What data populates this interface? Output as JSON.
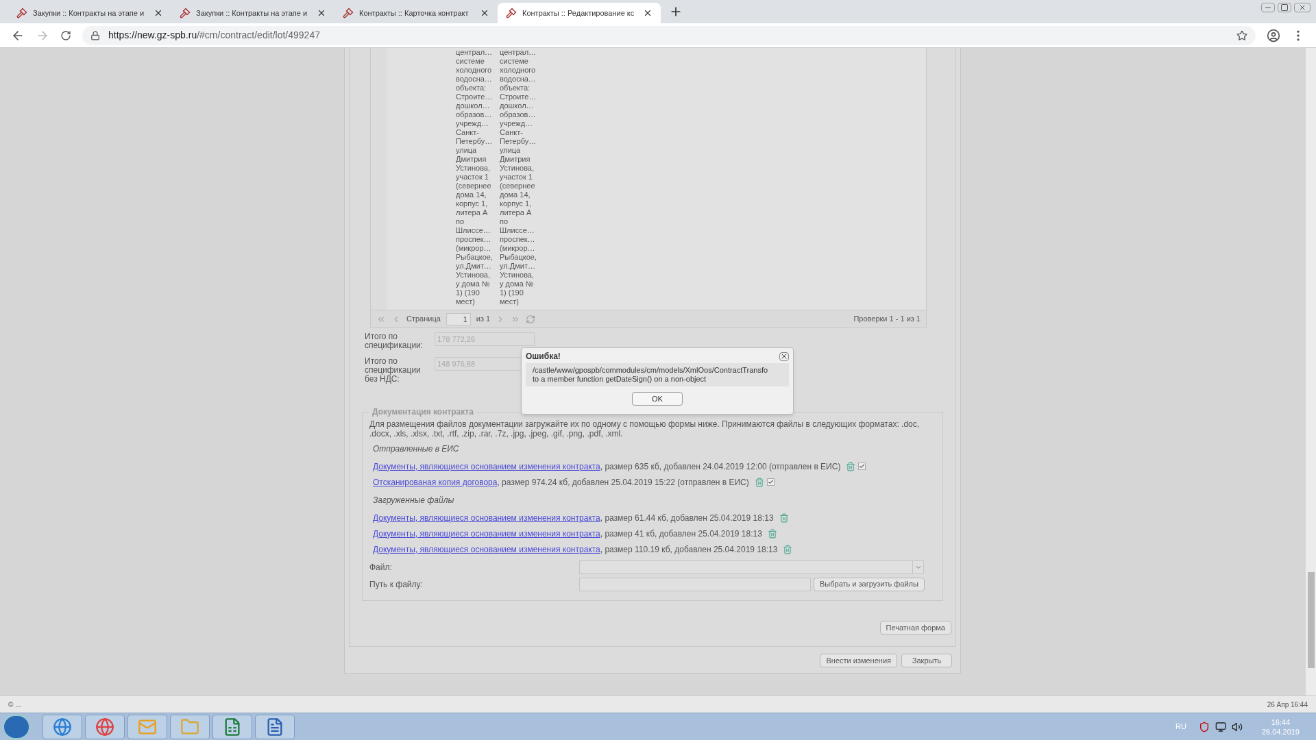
{
  "browser": {
    "tabs": [
      {
        "title": "Закупки :: Контракты на этапе и",
        "selected": false
      },
      {
        "title": "Закупки :: Контракты на этапе и",
        "selected": false
      },
      {
        "title": "Контракты :: Карточка контракт",
        "selected": false
      },
      {
        "title": "Контракты :: Редактирование кс",
        "selected": true
      }
    ],
    "url_host": "https://new.gz-spb.ru",
    "url_path": "/#cm/contract/edit/lot/499247"
  },
  "grid": {
    "rows": [
      {
        "column_1": "централ…\nсистеме\nхолодного\nводосна…\nобъекта:\nСтроите…\nдошкол…\nобразов…\nучрежд…\nСанкт-\nПетербу…\nулица\nДмитрия\nУстинова,\nучасток 1\n(севернее\nдома 14,\nкорпус 1,\nлитера А\nпо\nШлиссе…\nпроспек…\n(микрор…\nРыбацкое,\nул.Дмит…\nУстинова,\nу дома №\n1) (190\nмест)",
        "column_2": "централ…\nсистеме\nхолодного\nводосна…\nобъекта:\nСтроите…\nдошкол…\nобразов…\nучрежд…\nСанкт-\nПетербу…\nулица\nДмитрия\nУстинова,\nучасток 1\n(севернее\nдома 14,\nкорпус 1,\nлитера А\nпо\nШлиссе…\nпроспек…\n(микрор…\nРыбацкое,\nул.Дмит…\nУстинова,\nу дома №\n1) (190\nмест)"
      }
    ],
    "pager": {
      "page_label": "Страница",
      "page": "1",
      "of": "из 1",
      "summary": "Проверки 1 - 1 из 1"
    }
  },
  "totals": [
    {
      "label": "Итого по спецификации:",
      "value": "178 772,26"
    },
    {
      "label": "Итого по спецификации без НДС:",
      "value": "148 976,88"
    }
  ],
  "documents": {
    "legend": "Документация контракта",
    "intro": "Для размещения файлов документации загружайте их по одному с помощью формы ниже. Принимаются файлы в следующих форматах: .doc, .docx, .xls, .xlsx, .txt, .rtf, .zip, .rar, .7z, .jpg, .jpeg, .gif, .png, .pdf, .xml.",
    "groups": [
      {
        "heading": "Отправленные в ЕИС",
        "files": [
          {
            "kind": "sent",
            "link": "Документы, являющиеся основанием изменения контракта",
            "details": ", размер 635 кб, добавлен 24.04.2019 12:00 (отправлен в ЕИС)",
            "checked": true
          },
          {
            "kind": "sent",
            "link": "Отсканированая копия договора",
            "details": ", размер 974.24 кб, добавлен 25.04.2019 15:22 (отправлен в ЕИС)",
            "checked": true
          }
        ]
      },
      {
        "heading": "Загруженные файлы",
        "files": [
          {
            "kind": "uploaded",
            "link": "Документы, являющиеся основанием изменения контракта",
            "details": ", размер 61.44 кб, добавлен 25.04.2019 18:13"
          },
          {
            "kind": "uploaded",
            "link": "Документы, являющиеся основанием изменения контракта",
            "details": ", размер 41 кб, добавлен 25.04.2019 18:13"
          },
          {
            "kind": "uploaded",
            "link": "Документы, являющиеся основанием изменения контракта",
            "details": ", размер 110.19 кб, добавлен 25.04.2019 18:13"
          }
        ]
      }
    ],
    "file_label": "Файл:",
    "path_label": "Путь к файлу:",
    "upload_button": "Выбрать и загрузить файлы"
  },
  "print_button": "Печатная форма",
  "buttons": [
    "Внести изменения",
    "Закрыть"
  ],
  "dialog": {
    "title": "Ошибка!",
    "message": "/castle/www/gpospb/commodules/cm/models/XmlOos/ContractTransfo\nto a member function getDateSign() on a non-object",
    "ok": "OK"
  },
  "status_bar": {
    "left": "© ...",
    "right": "26 Апр 16:44"
  },
  "taskbar": {
    "language": "RU",
    "time": "16:44",
    "date": "26.04.2019"
  }
}
